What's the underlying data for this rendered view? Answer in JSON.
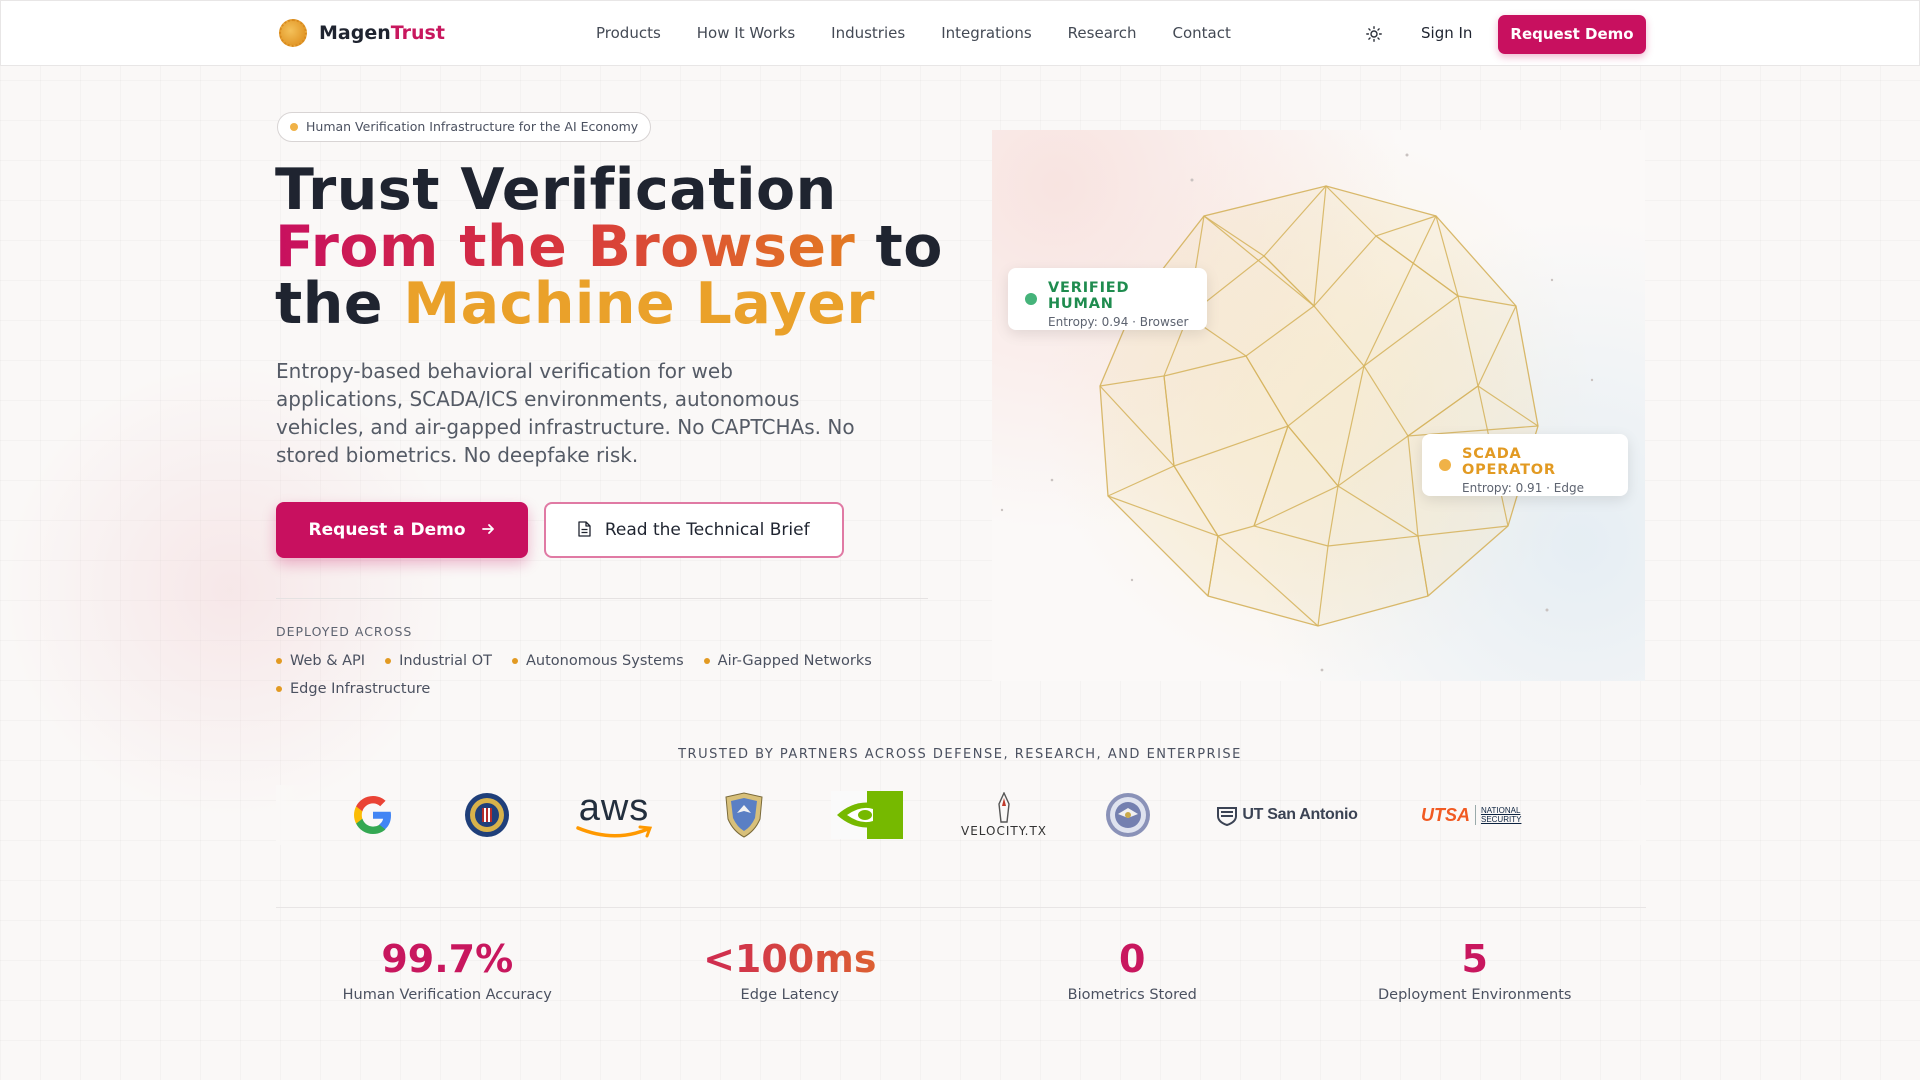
{
  "nav": {
    "brand_primary": "Magen",
    "brand_accent": "Trust",
    "links": [
      "Products",
      "How It Works",
      "Industries",
      "Integrations",
      "Research",
      "Contact"
    ],
    "theme_icon": "sun-icon",
    "sign_in": "Sign In",
    "request_demo": "Request Demo"
  },
  "hero": {
    "tag": "Human Verification Infrastructure for the AI Economy",
    "headline": {
      "line1": "Trust Verification",
      "line2_accent": "From the Browser",
      "line2_rest": " to",
      "line3_start": "the ",
      "line3_accent": "Machine Layer"
    },
    "subcopy": "Entropy-based behavioral verification for web applications, SCADA/ICS environments, autonomous vehicles, and air-gapped infrastructure. No CAPTCHAs. No stored biometrics. No deepfake risk.",
    "cta_primary": "Request a Demo",
    "cta_secondary": "Read the Technical Brief",
    "deployed_title": "DEPLOYED ACROSS",
    "deployed_items": [
      "Web & API",
      "Industrial OT",
      "Autonomous Systems",
      "Air-Gapped Networks",
      "Edge Infrastructure"
    ]
  },
  "visual": {
    "badge_human": {
      "title": "VERIFIED HUMAN",
      "sub": "Entropy: 0.94 · Browser"
    },
    "badge_scada": {
      "title": "SCADA OPERATOR",
      "sub": "Entropy: 0.91 · Edge"
    }
  },
  "partners": {
    "title": "TRUSTED BY PARTNERS ACROSS DEFENSE, RESEARCH, AND ENTERPRISE",
    "logos": [
      {
        "name": "google",
        "text": ""
      },
      {
        "name": "fbi-seal",
        "text": ""
      },
      {
        "name": "aws",
        "text": "aws"
      },
      {
        "name": "air-force-shield",
        "text": ""
      },
      {
        "name": "nvidia",
        "text": ""
      },
      {
        "name": "velocity-tx",
        "text": "VELOCITY.TX"
      },
      {
        "name": "dod-seal",
        "text": ""
      },
      {
        "name": "ut-san-antonio",
        "text": "UT San Antonio"
      },
      {
        "name": "utsa-nscc",
        "text": "UTSA",
        "sub": "NATIONAL SECURITY"
      }
    ]
  },
  "stats": [
    {
      "value": "99.7%",
      "label": "Human Verification Accuracy"
    },
    {
      "value": "<100ms",
      "label": "Edge Latency"
    },
    {
      "value": "0",
      "label": "Biometrics Stored"
    },
    {
      "value": "5",
      "label": "Deployment Environments"
    }
  ],
  "colors": {
    "brand": "#c8105f",
    "gold": "#eaa12a",
    "verified_green": "#1f8c4f",
    "scada_gold": "#e29a22"
  }
}
